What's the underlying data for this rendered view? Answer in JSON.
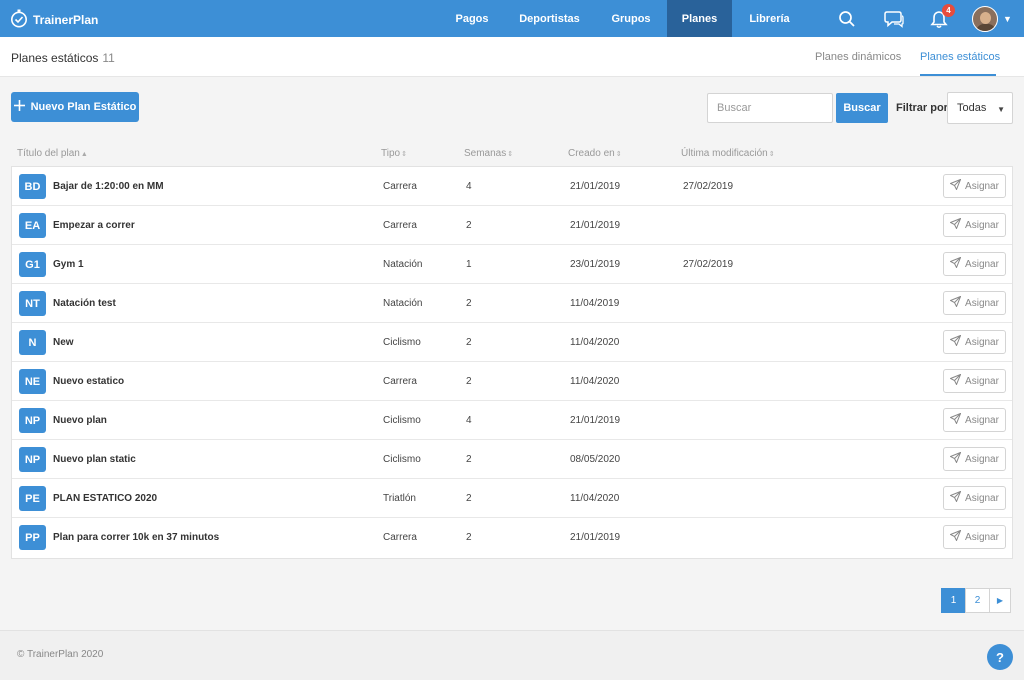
{
  "brand": {
    "name": "TrainerPlan"
  },
  "nav": {
    "items": [
      {
        "label": "Pagos",
        "active": false
      },
      {
        "label": "Deportistas",
        "active": false
      },
      {
        "label": "Grupos",
        "active": false
      },
      {
        "label": "Planes",
        "active": true
      },
      {
        "label": "Librería",
        "active": false
      }
    ],
    "notifications_count": "4",
    "icons": [
      "search-icon",
      "chat-icon",
      "bell-icon"
    ]
  },
  "subheader": {
    "title": "Planes estáticos",
    "count": "11",
    "tabs": [
      {
        "label": "Planes dinámicos",
        "active": false
      },
      {
        "label": "Planes estáticos",
        "active": true
      }
    ]
  },
  "toolbar": {
    "new_plan_label": "Nuevo Plan Estático",
    "search_placeholder": "Buscar",
    "search_value": "",
    "search_button": "Buscar",
    "filter_label": "Filtrar por",
    "filter_value": "Todas"
  },
  "table": {
    "columns": [
      "Título del plan",
      "Tipo",
      "Semanas",
      "Creado en",
      "Última modificación"
    ],
    "assign_label": "Asignar",
    "rows": [
      {
        "initials": "BD",
        "title": "Bajar de 1:20:00 en MM",
        "tipo": "Carrera",
        "semanas": "4",
        "creado": "21/01/2019",
        "modificado": "27/02/2019"
      },
      {
        "initials": "EA",
        "title": "Empezar a correr",
        "tipo": "Carrera",
        "semanas": "2",
        "creado": "21/01/2019",
        "modificado": ""
      },
      {
        "initials": "G1",
        "title": "Gym 1",
        "tipo": "Natación",
        "semanas": "1",
        "creado": "23/01/2019",
        "modificado": "27/02/2019"
      },
      {
        "initials": "NT",
        "title": "Natación test",
        "tipo": "Natación",
        "semanas": "2",
        "creado": "11/04/2019",
        "modificado": ""
      },
      {
        "initials": "N",
        "title": "New",
        "tipo": "Ciclismo",
        "semanas": "2",
        "creado": "11/04/2020",
        "modificado": ""
      },
      {
        "initials": "NE",
        "title": "Nuevo estatico",
        "tipo": "Carrera",
        "semanas": "2",
        "creado": "11/04/2020",
        "modificado": ""
      },
      {
        "initials": "NP",
        "title": "Nuevo plan",
        "tipo": "Ciclismo",
        "semanas": "4",
        "creado": "21/01/2019",
        "modificado": ""
      },
      {
        "initials": "NP",
        "title": "Nuevo plan static",
        "tipo": "Ciclismo",
        "semanas": "2",
        "creado": "08/05/2020",
        "modificado": ""
      },
      {
        "initials": "PE",
        "title": "PLAN ESTATICO 2020",
        "tipo": "Triatlón",
        "semanas": "2",
        "creado": "11/04/2020",
        "modificado": ""
      },
      {
        "initials": "PP",
        "title": "Plan para correr 10k en 37 minutos",
        "tipo": "Carrera",
        "semanas": "2",
        "creado": "21/01/2019",
        "modificado": ""
      }
    ]
  },
  "pagination": {
    "pages": [
      "1",
      "2"
    ],
    "current": "1"
  },
  "footer": {
    "copyright": "© TrainerPlan 2020",
    "help": "?"
  },
  "colors": {
    "primary": "#3d8fd6",
    "nav_active": "#29629a",
    "badge": "#e74c3c"
  }
}
